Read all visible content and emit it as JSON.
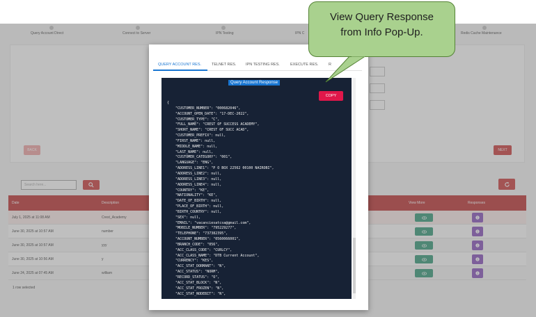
{
  "stepper": {
    "steps": [
      "Query Account Direct",
      "Connect to Server",
      "IPN Testing",
      "IPN C",
      "Redis Cache Maintenance"
    ]
  },
  "actions": {
    "back_label": "BACK",
    "next_label": "NEXT"
  },
  "search": {
    "placeholder": "Search here..."
  },
  "table": {
    "headers": {
      "date": "Date",
      "description": "Description",
      "view_more": "View More",
      "responses": "Responses"
    },
    "rows": [
      {
        "date": "July 1, 2025 at 11:08 AM",
        "description": "Crest_Academy"
      },
      {
        "date": "June 30, 2025 at 10:57 AM",
        "description": "number"
      },
      {
        "date": "June 30, 2025 at 10:57 AM",
        "description": "yyy"
      },
      {
        "date": "June 30, 2025 at 10:56 AM",
        "description": "y"
      },
      {
        "date": "June 24, 2025 at 07:45 AM",
        "description": "william"
      }
    ],
    "footer": "1 row selected"
  },
  "modal": {
    "tabs": [
      "QUERY ACCOUNT RES.",
      "TELNET RES.",
      "IPN TESTING RES.",
      "EXECUTE RES.",
      "R"
    ],
    "panel_title": "Query Account Response",
    "copy_label": "COPY",
    "json_text": "{\n    \"CUSTOMER_NUMBER\": \"000682046\",\n    \"ACCOUNT_OPEN_DATE\": \"17-DEC-2022\",\n    \"CUSTOMER_TYPE\": \"C\",\n    \"FULL_NAME\": \"CREST OF SUCCESS ACADEMY\",\n    \"SHORT_NAME\": \"CREST OF SUCC ACAD\",\n    \"CUSTOMER_PREFIX\": null,\n    \"FIRST_NAME\": null,\n    \"MIDDLE_NAME\": null,\n    \"LAST_NAME\": null,\n    \"CUSTOMER_CATEGORY\": \"001\",\n    \"LANGUAGE\": \"ENG\",\n    \"ADDRESS_LINE1\": \"P O BOX 22562 00100 NAIROBI\",\n    \"ADDRESS_LINE2\": null,\n    \"ADDRESS_LINE3\": null,\n    \"ADDRESS_LINE4\": null,\n    \"COUNTRY\": \"KE\",\n    \"NATIONALITY\": \"KE\",\n    \"DATE_OF_BIRTH\": null,\n    \"PLACE_OF_BIRTH\": null,\n    \"BIRTH_COUNTRY\": null,\n    \"SEX\": null,\n    \"EMAIL\": \"vacanciesatcsa@gmail.com\",\n    \"MOBILE_NUMBER\": \"795229277\",\n    \"TELEPHONE\": \"737382395\",\n    \"ACCOUNT_NUMBER\": \"0560066001\",\n    \"BRANCH_CODE\": \"056\",\n    \"ACC_CLASS_CODE\": \"CURLCY\",\n    \"ACC_CLASS_NAME\": \"DTB Current Account\",\n    \"CURRENCY\": \"KES\",\n    \"ACC_STAT_DORMANT\": \"N\",\n    \"ACC_STATUS\": \"NORM\",\n    \"RECORD_STATUS\": \"O\",\n    \"ACC_STAT_BLOCK\": \"N\",\n    \"ACC_STAT_FROZEN\": \"N\",\n    \"ACC_STAT_NODEBIT\": \"N\","
  },
  "callout": {
    "line1": "View Query Response",
    "line2": "from Info Pop-Up."
  },
  "colors": {
    "brand_red": "#c62828",
    "tab_blue": "#1976d2",
    "callout_green": "#a9d18e",
    "view_green": "#1e8e6a",
    "response_purple": "#7b3fb5"
  }
}
